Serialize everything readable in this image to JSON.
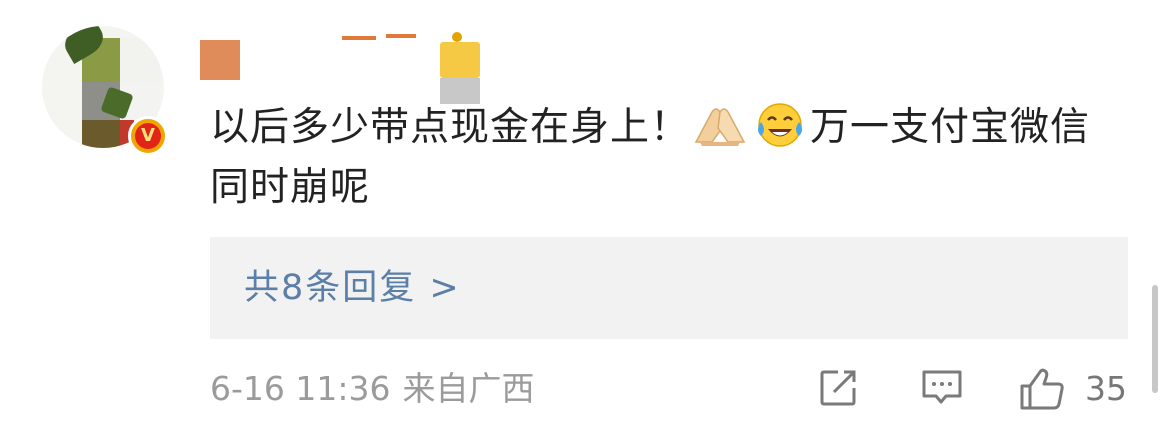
{
  "comment": {
    "text_part1": "以后多少带点现金在身上！",
    "emoji_1": "folded-hands-emoji",
    "emoji_2": "laughing-crying-emoji",
    "text_part2": "万一支付宝微信同时崩呢"
  },
  "verified_badge": {
    "letter": "V"
  },
  "replies": {
    "label": "共8条回复 >"
  },
  "meta": {
    "date": "6-16 11:36",
    "location": "来自广西"
  },
  "actions": {
    "like_count": "35"
  },
  "colors": {
    "link": "#5b7fa6",
    "meta_text": "#9b9b9b",
    "reply_bg": "#f2f2f2",
    "badge_red": "#e2231a",
    "badge_gold": "#f2a500"
  },
  "icons": [
    "share-icon",
    "comment-icon",
    "thumbs-up-icon"
  ]
}
